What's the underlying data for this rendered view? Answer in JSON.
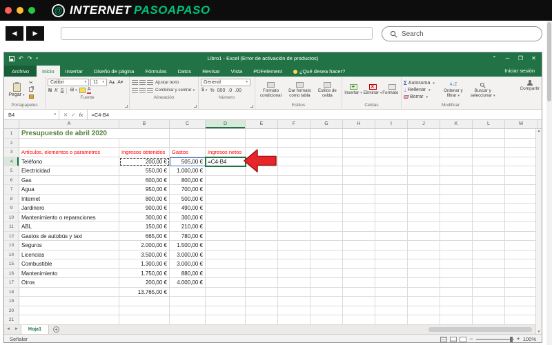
{
  "colors": {
    "excel_green": "#217346",
    "brand_green": "#00c07b",
    "arrow_red": "#e8262a",
    "header_red": "#ff0000",
    "title_green": "#538135"
  },
  "browser": {
    "logo": {
      "word1": "INTERNET",
      "word2": "PASOAPASO"
    },
    "search_placeholder": "Search"
  },
  "titlebar": {
    "title": "Libro1 - Excel (Error de activación de productos)"
  },
  "tabs": {
    "items": [
      "Archivo",
      "Inicio",
      "Insertar",
      "Diseño de página",
      "Fórmulas",
      "Datos",
      "Revisar",
      "Vista",
      "PDFelement"
    ],
    "selected": "Inicio",
    "tell_me": "¿Qué desea hacer?",
    "sign_in": "Iniciar sesión"
  },
  "ribbon": {
    "paste": "Pegar",
    "clipboard_group": "Portapapeles",
    "font_name": "Calibri",
    "font_size": "11",
    "bold": "N",
    "italic": "K",
    "underline": "S",
    "font_group": "Fuente",
    "wrap": "Ajustar texto",
    "merge": "Combinar y centrar",
    "align_group": "Alineación",
    "number_format": "General",
    "number_group": "Número",
    "cond_format": "Formato condicional",
    "format_table": "Dar formato como tabla",
    "cell_styles": "Estilos de celda",
    "styles_group": "Estilos",
    "insert": "Insertar",
    "delete": "Eliminar",
    "format": "Formato",
    "cells_group": "Celdas",
    "autosum": "Autosuma",
    "fill": "Rellenar",
    "clear": "Borrar",
    "sort": "Ordenar y filtrar",
    "find": "Buscar y seleccionar",
    "edit_group": "Modificar",
    "share": "Compartir"
  },
  "formula_bar": {
    "name_box": "B4",
    "formula": "=C4-B4"
  },
  "sheet": {
    "columns": [
      "A",
      "B",
      "C",
      "D",
      "E",
      "F",
      "G",
      "H",
      "I",
      "J",
      "K",
      "L",
      "M"
    ],
    "selected_col": "D",
    "selected_row": 4,
    "rows": [
      {
        "n": 1,
        "cells": {
          "a": "Presupuesto de abril 2020"
        }
      },
      {
        "n": 2,
        "cells": {}
      },
      {
        "n": 3,
        "cells": {
          "a": "Artículos, elementos o parametros",
          "b": "Ingresos obtenidos",
          "c": "Gastos",
          "d": "Ingresos netos"
        }
      },
      {
        "n": 4,
        "cells": {
          "a": "Teléfono",
          "b": "200,00 €",
          "c": "505,00 €",
          "d": "=C4-B4"
        }
      },
      {
        "n": 5,
        "cells": {
          "a": "Electricidad",
          "b": "550,00 €",
          "c": "1.000,00 €"
        }
      },
      {
        "n": 6,
        "cells": {
          "a": "Gas",
          "b": "600,00 €",
          "c": "800,00 €"
        }
      },
      {
        "n": 7,
        "cells": {
          "a": "Agua",
          "b": "950,00 €",
          "c": "700,00 €"
        }
      },
      {
        "n": 8,
        "cells": {
          "a": "Internet",
          "b": "800,00 €",
          "c": "500,00 €"
        }
      },
      {
        "n": 9,
        "cells": {
          "a": "Jardinero",
          "b": "900,00 €",
          "c": "490,00 €"
        }
      },
      {
        "n": 10,
        "cells": {
          "a": "Mantenimiento o reparaciones",
          "b": "300,00 €",
          "c": "300,00 €"
        }
      },
      {
        "n": 11,
        "cells": {
          "a": "ABL",
          "b": "150,00 €",
          "c": "210,00 €"
        }
      },
      {
        "n": 12,
        "cells": {
          "a": "Gastos de autobús y taxi",
          "b": "665,00 €",
          "c": "780,00 €"
        }
      },
      {
        "n": 13,
        "cells": {
          "a": "Seguros",
          "b": "2.000,00 €",
          "c": "1.500,00 €"
        }
      },
      {
        "n": 14,
        "cells": {
          "a": "Licencias",
          "b": "3.500,00 €",
          "c": "3.000,00 €"
        }
      },
      {
        "n": 15,
        "cells": {
          "a": "Combustible",
          "b": "1.300,00 €",
          "c": "3.000,00 €"
        }
      },
      {
        "n": 16,
        "cells": {
          "a": "Mantenimiento",
          "b": "1.750,00 €",
          "c": "880,00 €"
        }
      },
      {
        "n": 17,
        "cells": {
          "a": "Otros",
          "b": "200,00 €",
          "c": "4.000,00 €"
        }
      },
      {
        "n": 18,
        "cells": {
          "b": "13.765,00 €"
        }
      },
      {
        "n": 19,
        "cells": {}
      },
      {
        "n": 20,
        "cells": {}
      },
      {
        "n": 21,
        "cells": {}
      }
    ]
  },
  "sheet_tabs": {
    "active": "Hoja1"
  },
  "status_bar": {
    "mode": "Señalar",
    "zoom": "100%"
  }
}
